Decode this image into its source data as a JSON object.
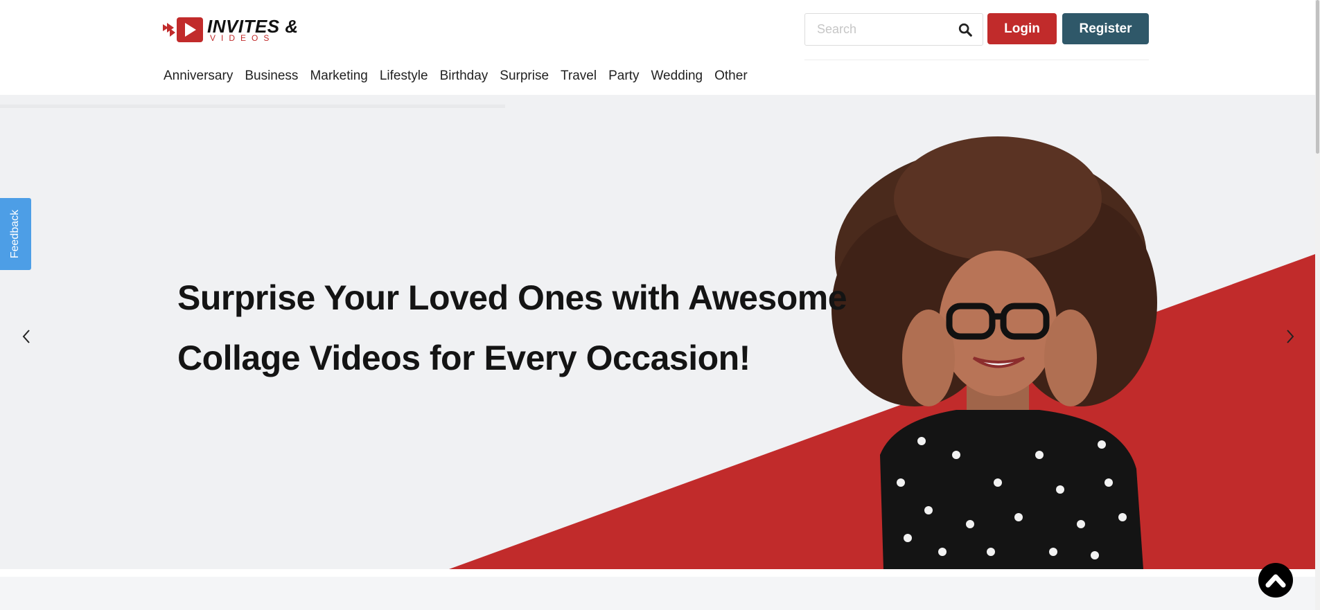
{
  "header": {
    "logo": {
      "title": "INVITES &",
      "subtitle": "VIDEOS"
    },
    "search": {
      "placeholder": "Search",
      "icon": "search-icon"
    },
    "login_label": "Login",
    "register_label": "Register",
    "nav": [
      {
        "label": "Anniversary"
      },
      {
        "label": "Business"
      },
      {
        "label": "Marketing"
      },
      {
        "label": "Lifestyle"
      },
      {
        "label": "Birthday"
      },
      {
        "label": "Surprise"
      },
      {
        "label": "Travel"
      },
      {
        "label": "Party"
      },
      {
        "label": "Wedding"
      },
      {
        "label": "Other"
      }
    ]
  },
  "hero": {
    "headline_line1": "Surprise Your Loved Ones with Awesome",
    "headline_line2": "Collage Videos for Every Occasion!",
    "prev_icon": "chevron-left-icon",
    "next_icon": "chevron-right-icon"
  },
  "feedback_label": "Feedback",
  "colors": {
    "brand_red": "#c12b2b",
    "register_teal": "#2f5869",
    "feedback_blue": "#4d9ee6",
    "hero_bg": "#f0f1f3"
  }
}
